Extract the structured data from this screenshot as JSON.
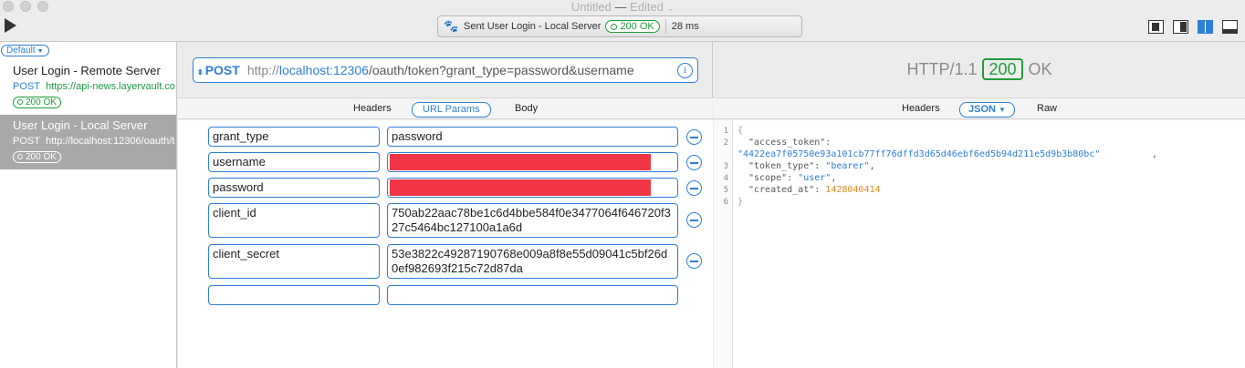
{
  "window": {
    "title": "Untitled",
    "dash": "—",
    "edited": "Edited"
  },
  "status_bar": {
    "sent_label": "Sent",
    "request_name": "User Login - Local Server",
    "status_text": "200 OK",
    "time": "28 ms"
  },
  "sidebar": {
    "filter": "Default",
    "requests": [
      {
        "name": "User Login - Remote Server",
        "method": "POST",
        "url": "https://api-news.layervault.com/oauth/token",
        "status": "200 OK",
        "selected": false
      },
      {
        "name": "User Login - Local Server",
        "method": "POST",
        "url": "http://localhost:12306/oauth/token",
        "status": "200 OK",
        "selected": true
      }
    ]
  },
  "request": {
    "method": "POST",
    "url_scheme": "http://",
    "url_host": "localhost:12306",
    "url_rest": "/oauth/token?grant_type=password&username",
    "tabs": {
      "headers": "Headers",
      "url_params": "URL Params",
      "body": "Body"
    },
    "params": [
      {
        "key": "grant_type",
        "value": "password",
        "redacted": false
      },
      {
        "key": "username",
        "value": "",
        "redacted": true
      },
      {
        "key": "password",
        "value": "",
        "redacted": true
      },
      {
        "key": "client_id",
        "value": "750ab22aac78be1c6d4bbe584f0e3477064f646720f327c5464bc127100a1a6d",
        "redacted": false
      },
      {
        "key": "client_secret",
        "value": "53e3822c49287190768e009a8f8e55d09041c5bf26d0ef982693f215c72d87da",
        "redacted": false
      },
      {
        "key": "",
        "value": "",
        "redacted": false
      }
    ]
  },
  "response": {
    "protocol": "HTTP/1.1",
    "code": "200",
    "reason": "OK",
    "tabs": {
      "headers": "Headers",
      "json": "JSON",
      "raw": "Raw"
    },
    "json": {
      "access_token_key": "\"access_token\"",
      "access_token": "\"4422ea7f05750e93a101cb77ff76dffd3d65d46ebf6ed5b94d211e5d9b3b80bc\"",
      "token_type_key": "\"token_type\"",
      "token_type": "\"bearer\"",
      "scope_key": "\"scope\"",
      "scope": "\"user\"",
      "created_at_key": "\"created_at\"",
      "created_at": "1428040414"
    }
  },
  "colors": {
    "accent": "#2d7fd6",
    "success": "#1e9e3b",
    "redaction": "#f23645",
    "selected_row": "#a9a9a9"
  }
}
